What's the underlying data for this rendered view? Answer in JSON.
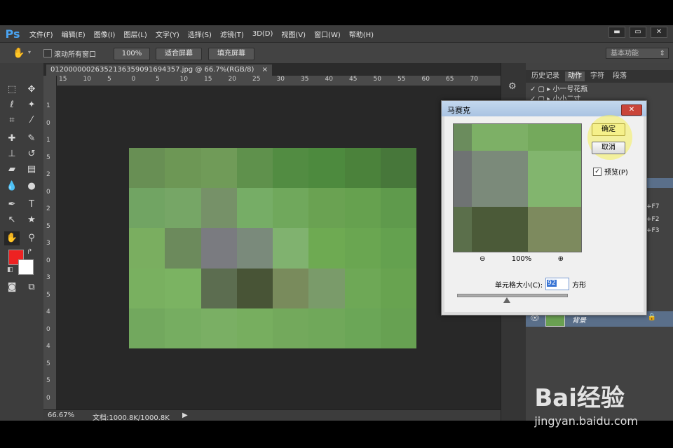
{
  "app": {
    "logo": "Ps"
  },
  "menu": [
    "文件(F)",
    "编辑(E)",
    "图像(I)",
    "图层(L)",
    "文字(Y)",
    "选择(S)",
    "滤镜(T)",
    "3D(D)",
    "视图(V)",
    "窗口(W)",
    "帮助(H)"
  ],
  "window_controls": {
    "minimize": "▬",
    "restore": "▭",
    "close": "✕"
  },
  "options_bar": {
    "scroll_all_windows": "滚动所有窗口",
    "zoom_100": "100%",
    "fit_screen": "适合屏幕",
    "fill_screen": "填充屏幕",
    "workspace": "基本功能"
  },
  "document": {
    "tab_title": "012000000263521363590916943​57.jpg @ 66.7%(RGB/8)",
    "tab_close": "×",
    "zoom_status": "66.67%",
    "doc_size": "文档:1000.8K/1000.8K"
  },
  "rulers": {
    "top": [
      "15",
      "10",
      "5",
      "0",
      "5",
      "10",
      "15",
      "20",
      "25",
      "30",
      "35",
      "40",
      "45",
      "50",
      "55",
      "60",
      "65",
      "70"
    ],
    "left": [
      "1",
      "0",
      "1",
      "5",
      "2",
      "0",
      "2",
      "5",
      "3",
      "0",
      "3",
      "5",
      "4",
      "0",
      "4",
      "5",
      "5",
      "0"
    ]
  },
  "panels": {
    "tabs": [
      "历史记录",
      "动作",
      "字符",
      "段落"
    ],
    "action_items": [
      "小一号花瓶",
      "小小二寸"
    ],
    "shortcuts": [
      "+F7",
      "+F2",
      "+F3"
    ],
    "layer_name": "背景"
  },
  "dialog": {
    "title": "马赛克",
    "ok": "确定",
    "cancel": "取消",
    "preview_label": "预览(P)",
    "preview_checked": "✓",
    "zoom_level": "100%",
    "cell_size_label": "单元格大小(C):",
    "cell_size_value": "92",
    "unit": "方形"
  },
  "watermark": {
    "brand": "Bai经验",
    "url": "jingyan.baidu.com"
  },
  "colors": {
    "foreground": "#ee2222",
    "background": "#ffffff",
    "mosaic": [
      "#688f54",
      "#6d9755",
      "#709b58",
      "#5f914c",
      "#528c42",
      "#4d8a3e",
      "#4b823b",
      "#47773a",
      "#71a463",
      "#76a666",
      "#769168",
      "#76ad66",
      "#70a85c",
      "#6aa252",
      "#66a14f",
      "#5f9a4c",
      "#7aae60",
      "#6c8a5c",
      "#7a7b80",
      "#7a8a7b",
      "#80b26f",
      "#6eaa52",
      "#6aa651",
      "#64a14f",
      "#79b060",
      "#7bb362",
      "#5c6d50",
      "#485436",
      "#798b5c",
      "#7a9b6a",
      "#6ea856",
      "#68a350",
      "#72a85e",
      "#76ad61",
      "#7aaf64",
      "#77ae5f",
      "#73a95c",
      "#70a85a",
      "#6ba657",
      "#67a152"
    ],
    "preview": [
      "#6b8c5d",
      "#7db066",
      "#74a95c",
      "#6f7373",
      "#7b8a7a",
      "#82b56e",
      "#5b6f4b",
      "#4b5a38",
      "#7d8a5e"
    ]
  }
}
